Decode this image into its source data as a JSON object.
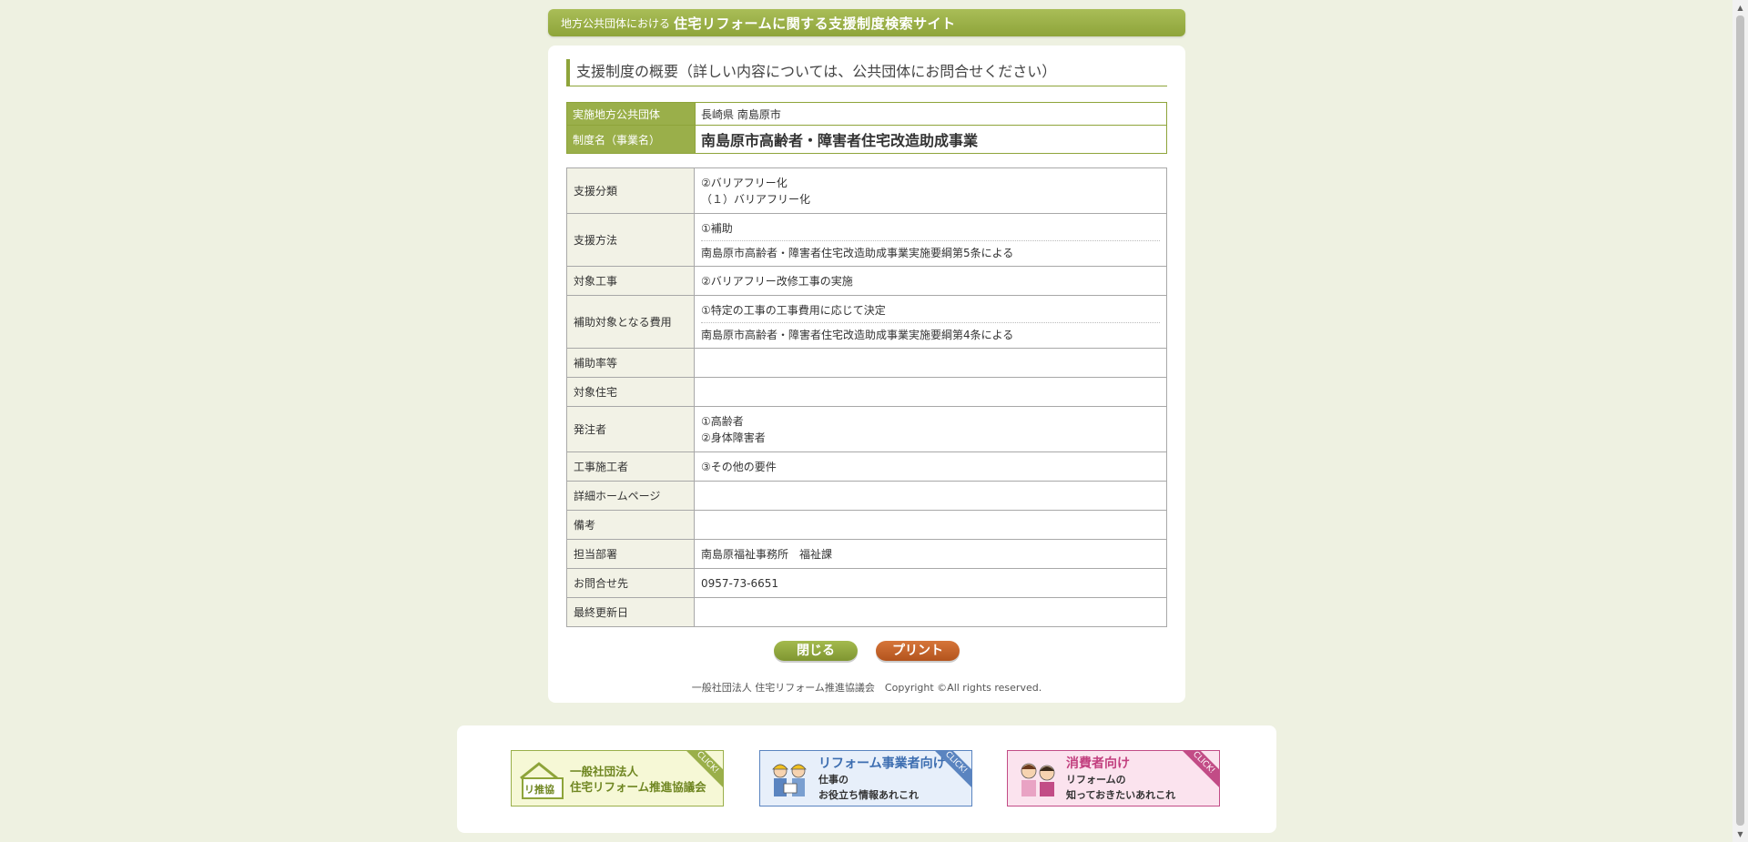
{
  "banner": {
    "small": "地方公共団体における",
    "big": "住宅リフォームに関する支援制度検索サイト"
  },
  "heading": "支援制度の概要（詳しい内容については、公共団体にお問合せください）",
  "top": {
    "org_label": "実施地方公共団体",
    "org_value": "長崎県 南島原市",
    "name_label": "制度名（事業名）",
    "name_value": "南島原市高齢者・障害者住宅改造助成事業"
  },
  "rows": {
    "category": {
      "label": "支援分類",
      "v1": "②バリアフリー化",
      "v2": "（１）バリアフリー化"
    },
    "method": {
      "label": "支援方法",
      "v1": "①補助",
      "v2": "南島原市高齢者・障害者住宅改造助成事業実施要綱第5条による"
    },
    "work": {
      "label": "対象工事",
      "v1": "②バリアフリー改修工事の実施"
    },
    "cost": {
      "label": "補助対象となる費用",
      "v1": "①特定の工事の工事費用に応じて決定",
      "v2": "南島原市高齢者・障害者住宅改造助成事業実施要綱第4条による"
    },
    "rate": {
      "label": "補助率等",
      "v1": ""
    },
    "house": {
      "label": "対象住宅",
      "v1": ""
    },
    "orderer": {
      "label": "発注者",
      "v1": "①高齢者",
      "v2": "②身体障害者"
    },
    "builder": {
      "label": "工事施工者",
      "v1": "③その他の要件"
    },
    "homepage": {
      "label": "詳細ホームページ",
      "v1": ""
    },
    "remarks": {
      "label": "備考",
      "v1": ""
    },
    "dept": {
      "label": "担当部署",
      "v1": "南島原福祉事務所　福祉課"
    },
    "contact": {
      "label": "お問合せ先",
      "v1": "0957-73-6651"
    },
    "updated": {
      "label": "最終更新日",
      "v1": ""
    }
  },
  "buttons": {
    "close": "閉じる",
    "print": "プリント"
  },
  "copyright": "一般社団法人 住宅リフォーム推進協議会　Copyright ©All rights reserved.",
  "footer": {
    "b1": {
      "icon_text": "リ推協",
      "l1": "一般社団法人",
      "l2": "住宅リフォーム推進協議会",
      "click": "CLICK!"
    },
    "b2": {
      "h": "リフォーム事業者向け",
      "s1": "仕事の",
      "s2": "お役立ち情報あれこれ",
      "click": "CLICK!"
    },
    "b3": {
      "h": "消費者向け",
      "s1": "リフォームの",
      "s2": "知っておきたいあれこれ",
      "click": "CLICK!"
    }
  },
  "colors": {
    "accent": "#8ea43a",
    "print": "#c2622a",
    "background": "#eef1e1"
  }
}
